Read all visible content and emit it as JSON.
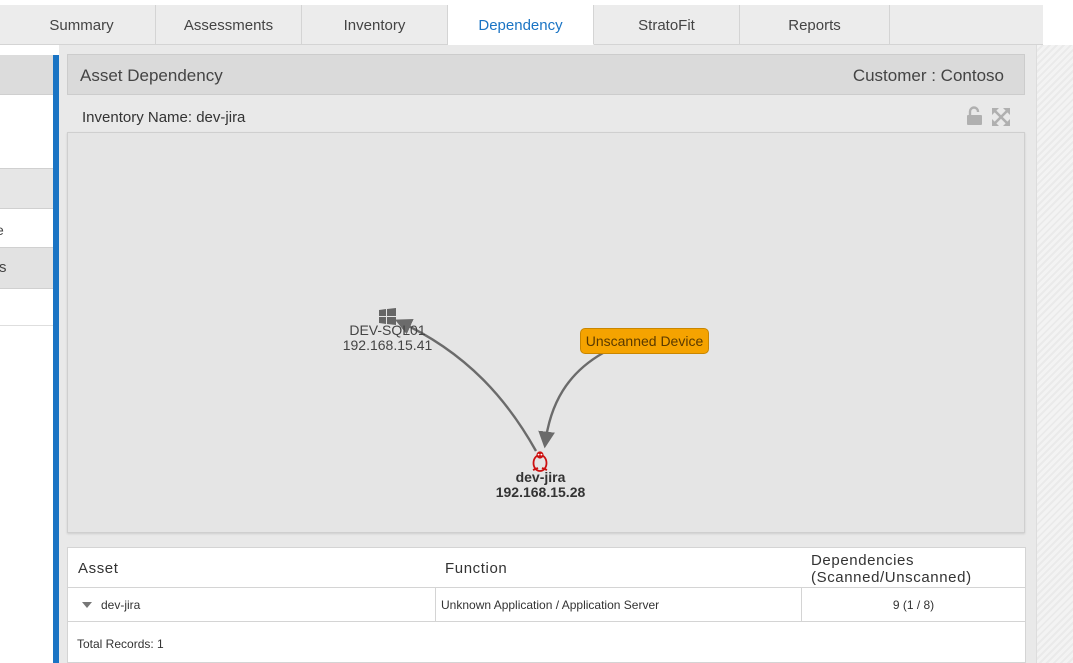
{
  "tabs": [
    {
      "label": "Summary"
    },
    {
      "label": "Assessments"
    },
    {
      "label": "Inventory"
    },
    {
      "label": "Dependency",
      "active": true
    },
    {
      "label": "StratoFit"
    },
    {
      "label": "Reports"
    }
  ],
  "sidebar": {
    "item_e": "e",
    "item_s": "s"
  },
  "panel": {
    "title": "Asset Dependency",
    "customer": "Customer : Contoso"
  },
  "inventory": {
    "label": "Inventory Name:",
    "value": "dev-jira"
  },
  "graph": {
    "nodes": [
      {
        "name": "DEV-SQL01",
        "ip": "192.168.15.41",
        "icon": "windows-icon"
      },
      {
        "name": "dev-jira",
        "ip": "192.168.15.28",
        "icon": "linux-icon"
      },
      {
        "name": "Unscanned Device"
      }
    ],
    "colors": {
      "unscanned": "#f5a300",
      "edge": "#6b6b6b",
      "linux_icon": "#cc1111"
    }
  },
  "table": {
    "headers": {
      "asset": "Asset",
      "function": "Function",
      "dependencies_line1": "Dependencies",
      "dependencies_line2": "(Scanned/Unscanned)"
    },
    "rows": [
      {
        "asset": "dev-jira",
        "function": "Unknown Application / Application Server",
        "dependencies": "9 (1 / 8)"
      }
    ],
    "total": "Total Records: 1"
  },
  "colors": {
    "accent": "#1a74c4"
  }
}
